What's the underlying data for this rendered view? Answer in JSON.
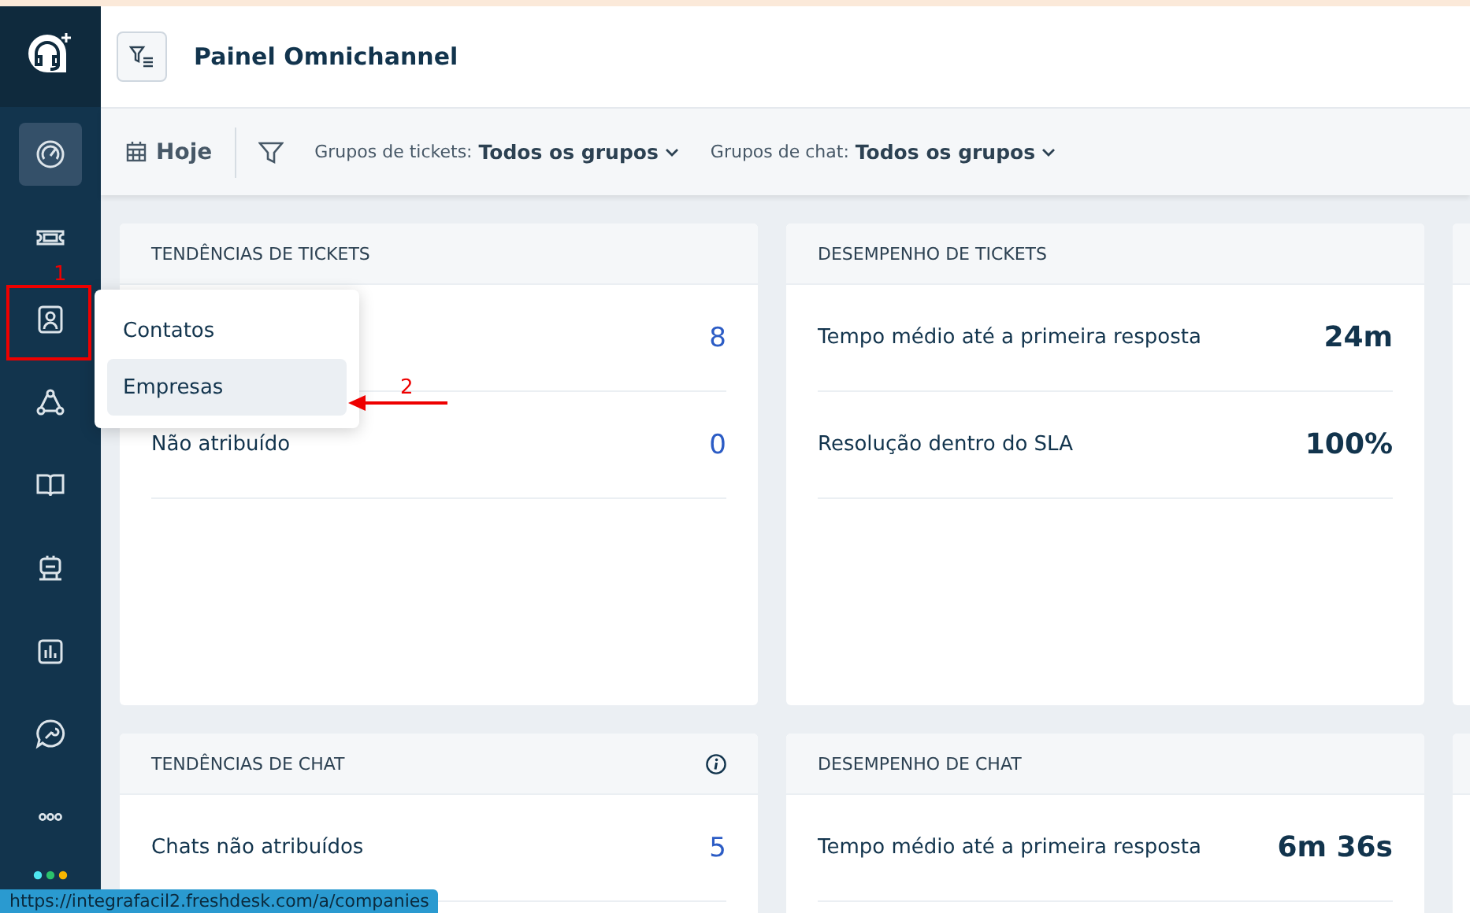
{
  "header": {
    "title": "Painel Omnichannel"
  },
  "sidebar": {
    "items": [
      {
        "selected": true
      },
      {
        "selected": false
      },
      {
        "selected": false
      },
      {
        "selected": false
      },
      {
        "selected": false
      },
      {
        "selected": false
      },
      {
        "selected": false
      },
      {
        "selected": false
      },
      {
        "selected": false
      }
    ]
  },
  "filter_bar": {
    "date": "Hoje",
    "filters": [
      {
        "label": "Grupos de tickets:",
        "value": "Todos os grupos"
      },
      {
        "label": "Grupos de chat:",
        "value": "Todos os grupos"
      }
    ]
  },
  "popover_menu": {
    "items": [
      {
        "label": "Contatos",
        "selected": false
      },
      {
        "label": "Empresas",
        "selected": true
      }
    ]
  },
  "annotations": [
    {
      "kind": "box",
      "label": "1"
    },
    {
      "kind": "arrow",
      "label": "2"
    }
  ],
  "cards": [
    {
      "title": "TENDÊNCIAS DE TICKETS",
      "kind": "trend",
      "info": false,
      "rows": [
        {
          "value": "8"
        },
        {
          "label": "Não atribuído",
          "value": "0"
        }
      ]
    },
    {
      "title": "DESEMPENHO DE TICKETS",
      "kind": "performance",
      "info": false,
      "rows": [
        {
          "label": "Tempo médio até a primeira resposta",
          "value": "24m"
        },
        {
          "label": "Resolução dentro do SLA",
          "value": "100%"
        }
      ]
    },
    {
      "title": "TENDÊNCIAS DE CHAT",
      "kind": "trend",
      "info": true,
      "rows": [
        {
          "label": "Chats não atribuídos",
          "value": "5"
        }
      ]
    },
    {
      "title": "DESEMPENHO DE CHAT",
      "kind": "performance",
      "info": false,
      "rows": [
        {
          "label": "Tempo médio até a primeira resposta",
          "value": "6m 36s"
        }
      ]
    }
  ],
  "status_url": "https://integrafacil2.freshdesk.com/a/companies"
}
